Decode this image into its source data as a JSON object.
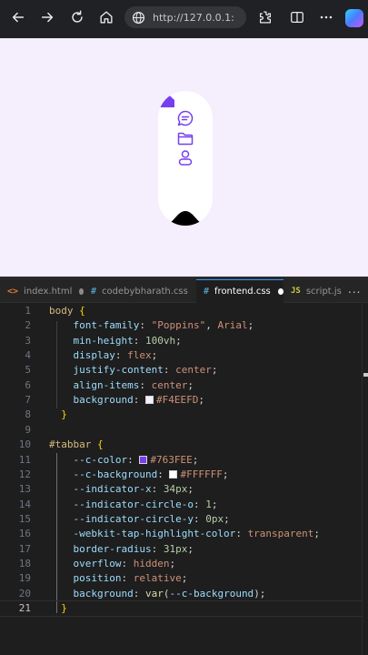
{
  "browser": {
    "url": "http://127.0.0.1:",
    "icons": [
      "back-icon",
      "forward-icon",
      "refresh-icon",
      "home-icon",
      "site-info-icon",
      "extensions-icon",
      "split-screen-icon",
      "favorites-icon",
      "more-icon",
      "copilot-icon"
    ]
  },
  "preview": {
    "background": "#F4EEFD",
    "tabbar": {
      "color": "#763FEE",
      "background": "#FFFFFF",
      "icons": [
        "home-icon",
        "chat-icon",
        "folder-icon",
        "user-icon"
      ]
    }
  },
  "editor": {
    "tabs": [
      {
        "icon": "<>",
        "label": "index.html",
        "modified": true,
        "active": false
      },
      {
        "icon": "#",
        "label": "codebybharath.css",
        "modified": false,
        "active": false
      },
      {
        "icon": "#",
        "label": "frontend.css",
        "modified": true,
        "active": true
      },
      {
        "icon": "JS",
        "label": "script.js",
        "modified": false,
        "active": false
      }
    ],
    "more_label": "...",
    "current_line": 21,
    "lines": [
      {
        "n": "1",
        "tokens": [
          [
            "sel",
            "body"
          ],
          [
            "punc",
            " "
          ],
          [
            "brace",
            "{"
          ]
        ]
      },
      {
        "n": "2",
        "tokens": [
          [
            "prop",
            "    font-family"
          ],
          [
            "punc",
            ": "
          ],
          [
            "str",
            "\"Poppins\""
          ],
          [
            "punc",
            ", "
          ],
          [
            "val",
            "Arial"
          ],
          [
            "punc",
            ";"
          ]
        ]
      },
      {
        "n": "3",
        "tokens": [
          [
            "prop",
            "    min-height"
          ],
          [
            "punc",
            ": "
          ],
          [
            "num",
            "100vh"
          ],
          [
            "punc",
            ";"
          ]
        ]
      },
      {
        "n": "4",
        "tokens": [
          [
            "prop",
            "    display"
          ],
          [
            "punc",
            ": "
          ],
          [
            "val",
            "flex"
          ],
          [
            "punc",
            ";"
          ]
        ]
      },
      {
        "n": "5",
        "tokens": [
          [
            "prop",
            "    justify-content"
          ],
          [
            "punc",
            ": "
          ],
          [
            "val",
            "center"
          ],
          [
            "punc",
            ";"
          ]
        ]
      },
      {
        "n": "6",
        "tokens": [
          [
            "prop",
            "    align-items"
          ],
          [
            "punc",
            ": "
          ],
          [
            "val",
            "center"
          ],
          [
            "punc",
            ";"
          ]
        ]
      },
      {
        "n": "7",
        "tokens": [
          [
            "prop",
            "    background"
          ],
          [
            "punc",
            ": "
          ],
          [
            "swatch",
            "#F4EEFD"
          ],
          [
            "val",
            "#F4EEFD"
          ],
          [
            "punc",
            ";"
          ]
        ]
      },
      {
        "n": "8",
        "tokens": [
          [
            "brace",
            "  }"
          ]
        ]
      },
      {
        "n": "9",
        "tokens": []
      },
      {
        "n": "10",
        "tokens": [
          [
            "sel",
            "#tabbar"
          ],
          [
            "punc",
            " "
          ],
          [
            "brace",
            "{"
          ]
        ]
      },
      {
        "n": "11",
        "tokens": [
          [
            "prop",
            "    --c-color"
          ],
          [
            "punc",
            ": "
          ],
          [
            "swatch",
            "#763FEE"
          ],
          [
            "val",
            "#763FEE"
          ],
          [
            "punc",
            ";"
          ]
        ]
      },
      {
        "n": "12",
        "tokens": [
          [
            "prop",
            "    --c-background"
          ],
          [
            "punc",
            ": "
          ],
          [
            "swatch",
            "#FFFFFF"
          ],
          [
            "val",
            "#FFFFFF"
          ],
          [
            "punc",
            ";"
          ]
        ]
      },
      {
        "n": "13",
        "tokens": [
          [
            "prop",
            "    --indicator-x"
          ],
          [
            "punc",
            ": "
          ],
          [
            "num",
            "34px"
          ],
          [
            "punc",
            ";"
          ]
        ]
      },
      {
        "n": "14",
        "tokens": [
          [
            "prop",
            "    --indicator-circle-o"
          ],
          [
            "punc",
            ": "
          ],
          [
            "num",
            "1"
          ],
          [
            "punc",
            ";"
          ]
        ]
      },
      {
        "n": "15",
        "tokens": [
          [
            "prop",
            "    --indicator-circle-y"
          ],
          [
            "punc",
            ": "
          ],
          [
            "num",
            "0px"
          ],
          [
            "punc",
            ";"
          ]
        ]
      },
      {
        "n": "16",
        "tokens": [
          [
            "prop",
            "    -webkit-tap-highlight-color"
          ],
          [
            "punc",
            ": "
          ],
          [
            "val",
            "transparent"
          ],
          [
            "punc",
            ";"
          ]
        ]
      },
      {
        "n": "17",
        "tokens": [
          [
            "prop",
            "    border-radius"
          ],
          [
            "punc",
            ": "
          ],
          [
            "num",
            "31px"
          ],
          [
            "punc",
            ";"
          ]
        ]
      },
      {
        "n": "18",
        "tokens": [
          [
            "prop",
            "    overflow"
          ],
          [
            "punc",
            ": "
          ],
          [
            "val",
            "hidden"
          ],
          [
            "punc",
            ";"
          ]
        ]
      },
      {
        "n": "19",
        "tokens": [
          [
            "prop",
            "    position"
          ],
          [
            "punc",
            ": "
          ],
          [
            "val",
            "relative"
          ],
          [
            "punc",
            ";"
          ]
        ]
      },
      {
        "n": "20",
        "tokens": [
          [
            "prop",
            "    background"
          ],
          [
            "punc",
            ": "
          ],
          [
            "fn",
            "var"
          ],
          [
            "punc",
            "("
          ],
          [
            "prop",
            "--c-background"
          ],
          [
            "punc",
            ");"
          ]
        ]
      },
      {
        "n": "21",
        "tokens": [
          [
            "brace",
            "  }"
          ]
        ]
      }
    ]
  }
}
